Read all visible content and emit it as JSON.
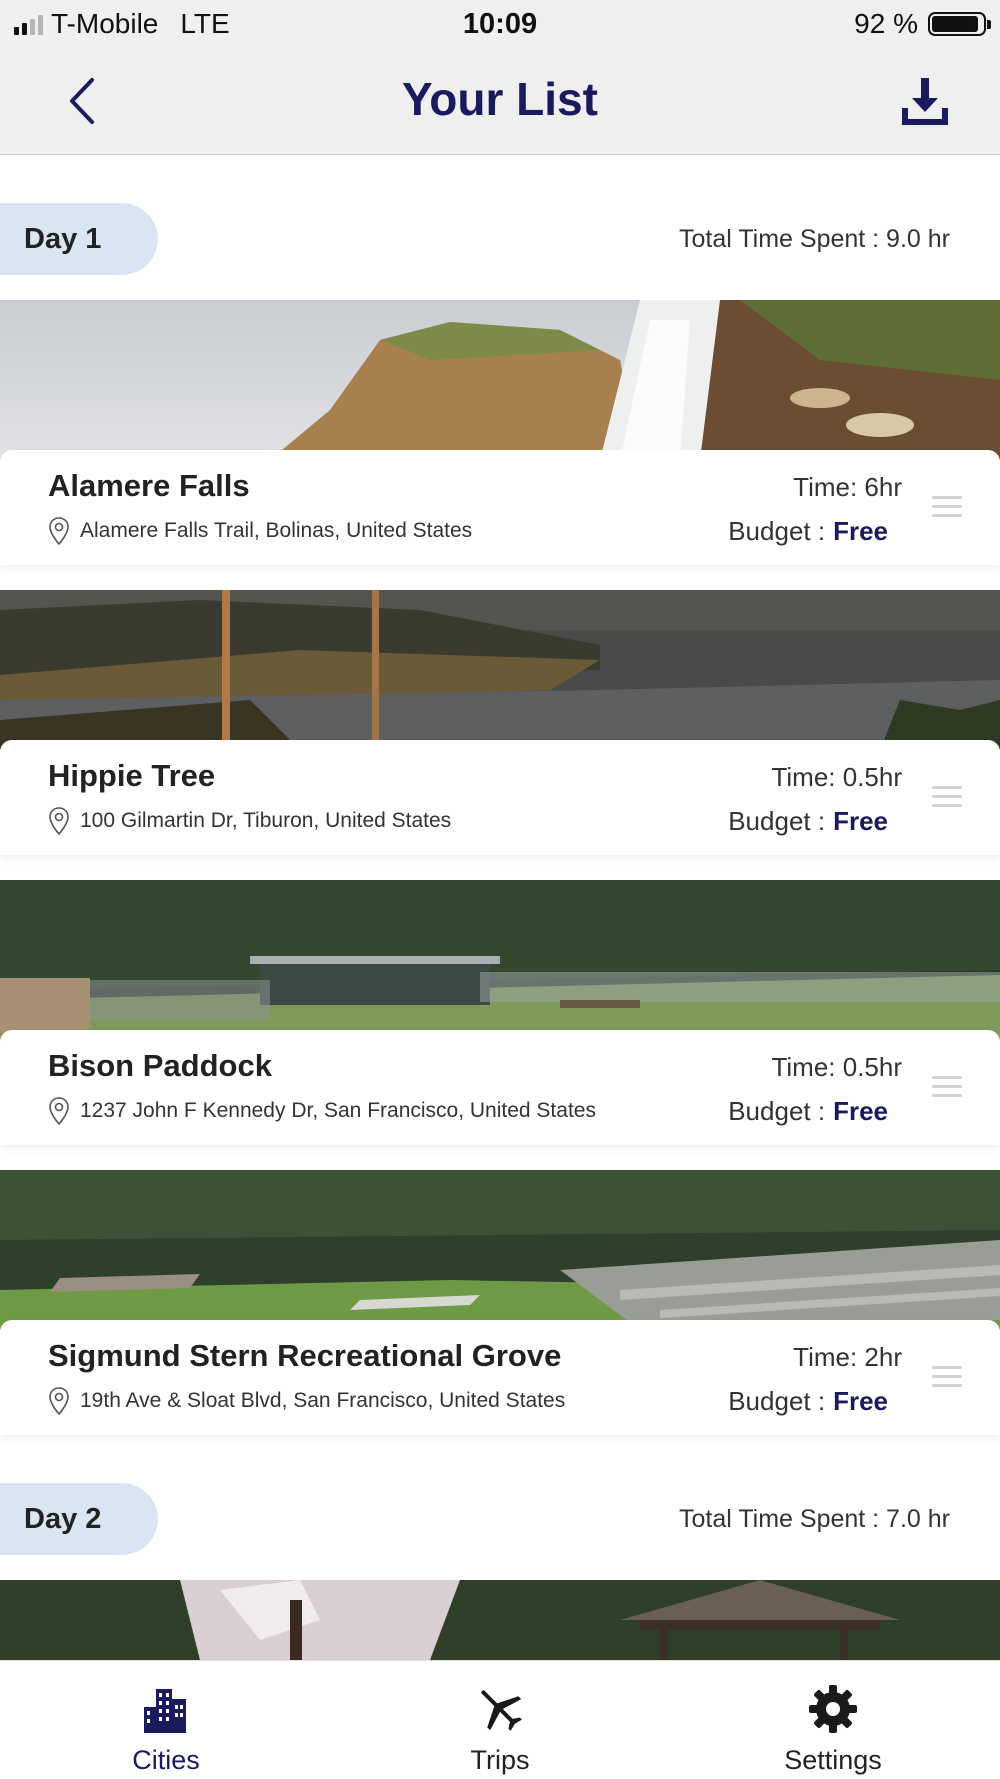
{
  "status_bar": {
    "carrier": "T-Mobile",
    "network": "LTE",
    "time": "10:09",
    "battery": "92 %"
  },
  "header": {
    "title": "Your List",
    "back_icon": "chevron-left-icon",
    "download_icon": "download-icon"
  },
  "days": [
    {
      "label": "Day 1",
      "total_time": "Total Time Spent : 9.0 hr"
    },
    {
      "label": "Day 2",
      "total_time": "Total Time Spent : 7.0 hr"
    }
  ],
  "places": [
    {
      "name": "Alamere Falls",
      "address": "Alamere Falls Trail, Bolinas, United States",
      "time": "Time: 6hr",
      "budget_label": "Budget :",
      "budget_value": "Free"
    },
    {
      "name": "Hippie Tree",
      "address": "100 Gilmartin Dr, Tiburon, United States",
      "time": "Time: 0.5hr",
      "budget_label": "Budget :",
      "budget_value": "Free"
    },
    {
      "name": "Bison Paddock",
      "address": "1237 John F Kennedy Dr, San Francisco, United States",
      "time": "Time: 0.5hr",
      "budget_label": "Budget :",
      "budget_value": "Free"
    },
    {
      "name": "Sigmund Stern Recreational Grove",
      "address": "19th Ave & Sloat Blvd, San Francisco, United States",
      "time": "Time: 2hr",
      "budget_label": "Budget :",
      "budget_value": "Free"
    }
  ],
  "tabs": [
    {
      "label": "Cities",
      "icon": "buildings-icon",
      "active": true
    },
    {
      "label": "Trips",
      "icon": "airplane-icon",
      "active": false
    },
    {
      "label": "Settings",
      "icon": "gear-icon",
      "active": false
    }
  ],
  "colors": {
    "accent": "#1a1a5e",
    "day_pill": "#d9e5f2",
    "header_bg": "#efefef"
  }
}
